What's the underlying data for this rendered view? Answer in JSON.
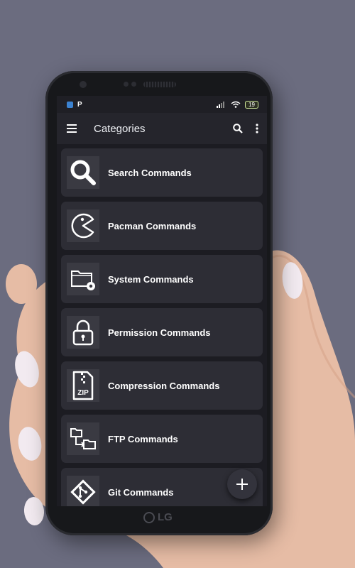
{
  "appbar": {
    "title": "Categories",
    "menu_icon": "hamburger-menu-icon",
    "search_icon": "search-icon",
    "overflow_icon": "more-vert-icon"
  },
  "statusbar": {
    "app_letter": "P",
    "battery": "19"
  },
  "categories": [
    {
      "label": "Search Commands",
      "icon": "magnifier-icon"
    },
    {
      "label": "Pacman Commands",
      "icon": "pacman-icon"
    },
    {
      "label": "System Commands",
      "icon": "folder-gear-icon"
    },
    {
      "label": "Permission Commands",
      "icon": "lock-icon"
    },
    {
      "label": "Compression Commands",
      "icon": "zip-file-icon"
    },
    {
      "label": "FTP Commands",
      "icon": "folder-transfer-icon"
    },
    {
      "label": "Git Commands",
      "icon": "git-icon"
    }
  ],
  "zip_text": "ZIP",
  "fab": {
    "icon": "plus-icon"
  },
  "device_brand": "LG",
  "colors": {
    "background": "#6b6c7f",
    "screen": "#1c1c22",
    "card": "#2d2d35",
    "icon_tile": "#3a3a42"
  }
}
